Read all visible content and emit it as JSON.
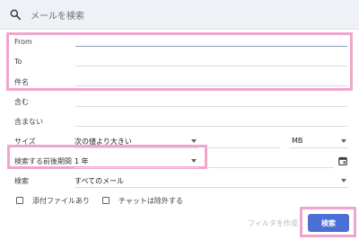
{
  "search": {
    "placeholder": "メールを検索"
  },
  "fields": {
    "from": "From",
    "to": "To",
    "subject": "件名",
    "has_words": "含む",
    "doesnt_have": "含まない",
    "size": "サイズ",
    "date_within": "検索する前後期間",
    "search_in": "検索"
  },
  "size_row": {
    "operator": "次の値より大きい",
    "unit": "MB"
  },
  "date_row": {
    "value": "1 年"
  },
  "search_in_row": {
    "value": "すべてのメール"
  },
  "checkboxes": {
    "has_attachment": "添付ファイルあり",
    "exclude_chats": "チャットは除外する"
  },
  "actions": {
    "create_filter": "フィルタを作成",
    "search": "検索"
  },
  "colors": {
    "highlight": "#f0a6cc",
    "primary_button": "#4b6fd4"
  }
}
